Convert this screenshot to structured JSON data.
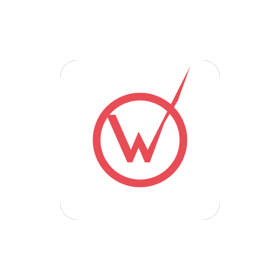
{
  "app_icon": {
    "name": "checkmark-w-logo",
    "colors": {
      "tile": "#ffffff",
      "corner_backdrop": "#000000",
      "mark": "#e84c55"
    }
  }
}
